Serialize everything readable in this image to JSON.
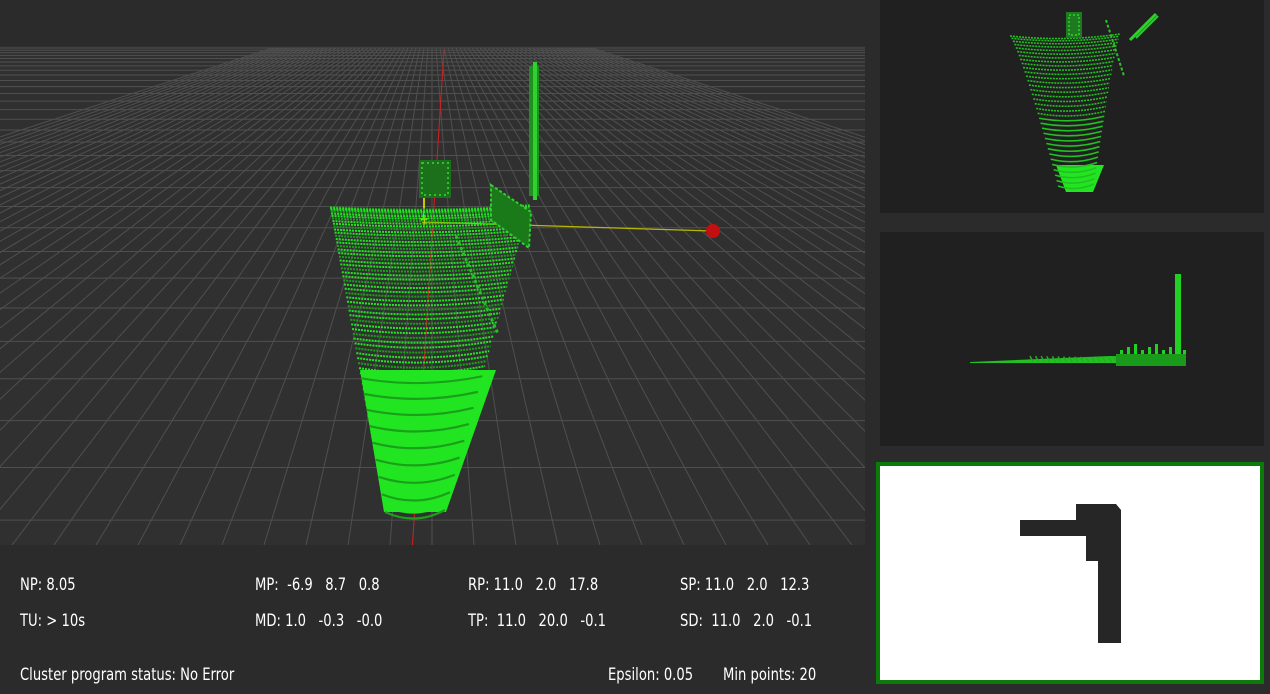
{
  "stats": {
    "np": "NP: 8.05",
    "tu": "TU: > 10s",
    "mp": "MP:  -6.9   8.7   0.8",
    "md": "MD: 1.0   -0.3   -0.0",
    "rp": "RP: 11.0   2.0   17.8",
    "tp": "TP:  11.0   20.0   -0.1",
    "sp": "SP: 11.0   2.0   12.3",
    "sd": "SD:  11.0   2.0   -0.1"
  },
  "status": {
    "cluster": "Cluster program status: No Error",
    "epsilon": "Epsilon: 0.05",
    "min_points": "Min points: 20"
  },
  "colors": {
    "point_cloud": "#22e522",
    "axis_red": "#d42020",
    "axis_yellow": "#c8c800",
    "frame_green": "#0b7a0b"
  }
}
